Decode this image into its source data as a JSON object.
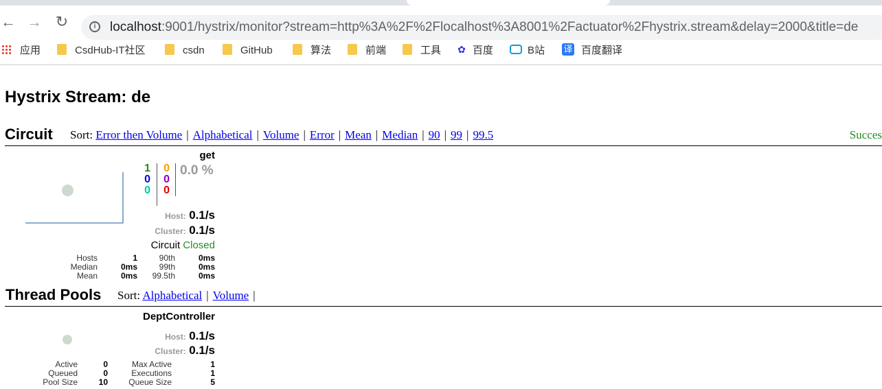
{
  "browser": {
    "url_host": "localhost",
    "url_rest": ":9001/hystrix/monitor?stream=http%3A%2F%2Flocalhost%3A8001%2Factuator%2Fhystrix.stream&delay=2000&title=de",
    "bookmarks": [
      {
        "label": "应用",
        "icon": "apps-grid-icon"
      },
      {
        "label": "CsdHub-IT社区",
        "icon": "folder-icon"
      },
      {
        "label": "csdn",
        "icon": "folder-icon"
      },
      {
        "label": "GitHub",
        "icon": "folder-icon"
      },
      {
        "label": "算法",
        "icon": "folder-icon"
      },
      {
        "label": "前端",
        "icon": "folder-icon"
      },
      {
        "label": "工具",
        "icon": "folder-icon"
      },
      {
        "label": "百度",
        "icon": "baidu-paw-icon"
      },
      {
        "label": "B站",
        "icon": "bilibili-tv-icon"
      },
      {
        "label": "百度翻译",
        "icon": "translate-icon"
      }
    ],
    "translate_glyph": "译"
  },
  "page": {
    "title": "Hystrix Stream: de"
  },
  "circuit": {
    "heading": "Circuit",
    "sort_label": "Sort:",
    "sort_options": [
      "Error then Volume",
      "Alphabetical",
      "Volume",
      "Error",
      "Mean",
      "Median",
      "90",
      "99",
      "99.5"
    ],
    "legend_success": "Succes",
    "card": {
      "name": "get",
      "success": "1",
      "short_circuited": "0",
      "bad_request": "0",
      "timeout": "0",
      "rejected": "0",
      "failure": "0",
      "error_pct": "0.0 %",
      "host_label": "Host:",
      "host_rate": "0.1/s",
      "cluster_label": "Cluster:",
      "cluster_rate": "0.1/s",
      "circuit_label": "Circuit",
      "circuit_state": "Closed",
      "stats": {
        "hosts_label": "Hosts",
        "hosts": "1",
        "median_label": "Median",
        "median": "0ms",
        "mean_label": "Mean",
        "mean": "0ms",
        "p90_label": "90th",
        "p90": "0ms",
        "p99_label": "99th",
        "p99": "0ms",
        "p995_label": "99.5th",
        "p995": "0ms"
      }
    }
  },
  "thread_pools": {
    "heading": "Thread Pools",
    "sort_label": "Sort:",
    "sort_options": [
      "Alphabetical",
      "Volume"
    ],
    "card": {
      "name": "DeptController",
      "host_label": "Host:",
      "host_rate": "0.1/s",
      "cluster_label": "Cluster:",
      "cluster_rate": "0.1/s",
      "stats": {
        "active_label": "Active",
        "active": "0",
        "queued_label": "Queued",
        "queued": "0",
        "pool_size_label": "Pool Size",
        "pool_size": "10",
        "max_active_label": "Max Active",
        "max_active": "1",
        "executions_label": "Executions",
        "executions": "1",
        "queue_size_label": "Queue Size",
        "queue_size": "5"
      }
    }
  },
  "colors": {
    "success": "#238b23",
    "short_circuited": "#0000ee",
    "bad_request": "#00c9a7",
    "timeout": "#f0a30a",
    "rejected": "#8e00b5",
    "failure": "#e00000",
    "link": "#0000ee"
  }
}
